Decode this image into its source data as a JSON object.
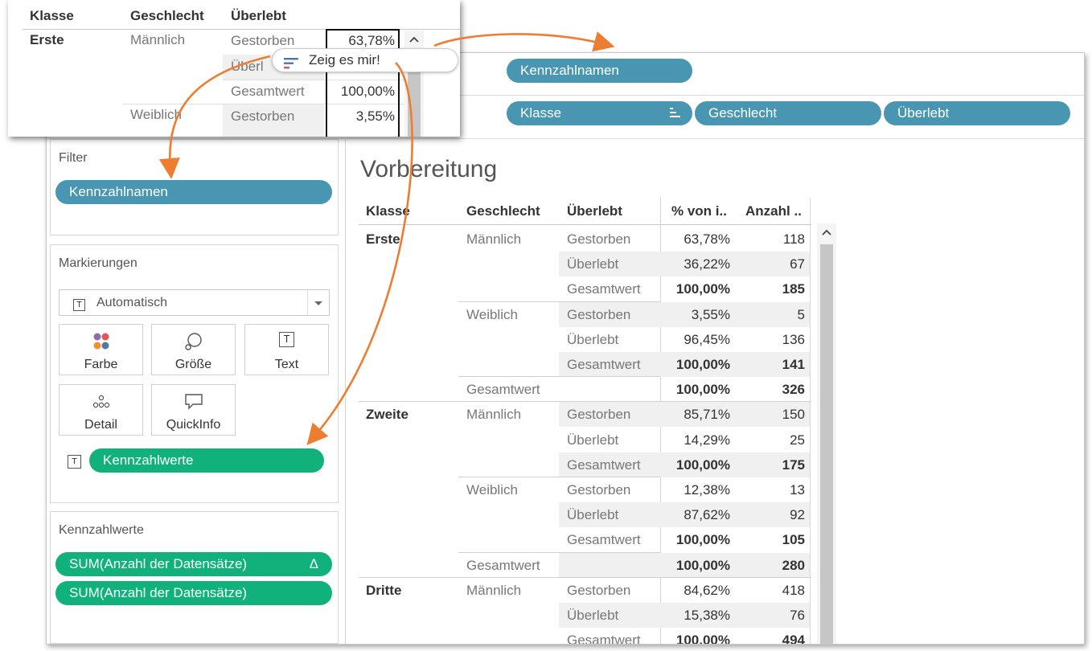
{
  "columns_shelf": {
    "pill": "Kennzahlnamen"
  },
  "rows_shelf": {
    "pills": [
      "Klasse",
      "Geschlecht",
      "Überlebt"
    ]
  },
  "filter": {
    "title": "Filter",
    "pill": "Kennzahlnamen"
  },
  "marks": {
    "title": "Markierungen",
    "type_value": "Automatisch",
    "buttons": [
      "Farbe",
      "Größe",
      "Text",
      "Detail",
      "QuickInfo"
    ],
    "text_pill": "Kennzahlwerte"
  },
  "measure_values": {
    "title": "Kennzahlwerte",
    "pills": [
      "SUM(Anzahl der Datensätze)",
      "SUM(Anzahl der Datensätze)"
    ],
    "delta": "Δ"
  },
  "sheet": {
    "title": "Vorbereitung"
  },
  "table": {
    "headers": [
      "Klasse",
      "Geschlecht",
      "Überlebt",
      "% von i..",
      "Anzahl .."
    ],
    "rows": [
      {
        "klasse": "Erste",
        "geschlecht": "Männlich",
        "ueberlebt": "Gestorben",
        "pct": "63,78%",
        "cnt": "118"
      },
      {
        "klasse": "",
        "geschlecht": "",
        "ueberlebt": "Überlebt",
        "pct": "36,22%",
        "cnt": "67"
      },
      {
        "klasse": "",
        "geschlecht": "",
        "ueberlebt": "Gesamtwert",
        "pct": "100,00%",
        "cnt": "185"
      },
      {
        "klasse": "",
        "geschlecht": "Weiblich",
        "ueberlebt": "Gestorben",
        "pct": "3,55%",
        "cnt": "5"
      },
      {
        "klasse": "",
        "geschlecht": "",
        "ueberlebt": "Überlebt",
        "pct": "96,45%",
        "cnt": "136"
      },
      {
        "klasse": "",
        "geschlecht": "",
        "ueberlebt": "Gesamtwert",
        "pct": "100,00%",
        "cnt": "141"
      },
      {
        "klasse": "",
        "geschlecht": "Gesamtwert",
        "ueberlebt": "",
        "pct": "100,00%",
        "cnt": "326"
      },
      {
        "klasse": "Zweite",
        "geschlecht": "Männlich",
        "ueberlebt": "Gestorben",
        "pct": "85,71%",
        "cnt": "150"
      },
      {
        "klasse": "",
        "geschlecht": "",
        "ueberlebt": "Überlebt",
        "pct": "14,29%",
        "cnt": "25"
      },
      {
        "klasse": "",
        "geschlecht": "",
        "ueberlebt": "Gesamtwert",
        "pct": "100,00%",
        "cnt": "175"
      },
      {
        "klasse": "",
        "geschlecht": "Weiblich",
        "ueberlebt": "Gestorben",
        "pct": "12,38%",
        "cnt": "13"
      },
      {
        "klasse": "",
        "geschlecht": "",
        "ueberlebt": "Überlebt",
        "pct": "87,62%",
        "cnt": "92"
      },
      {
        "klasse": "",
        "geschlecht": "",
        "ueberlebt": "Gesamtwert",
        "pct": "100,00%",
        "cnt": "105"
      },
      {
        "klasse": "",
        "geschlecht": "Gesamtwert",
        "ueberlebt": "",
        "pct": "100,00%",
        "cnt": "280"
      },
      {
        "klasse": "Dritte",
        "geschlecht": "Männlich",
        "ueberlebt": "Gestorben",
        "pct": "84,62%",
        "cnt": "418"
      },
      {
        "klasse": "",
        "geschlecht": "",
        "ueberlebt": "Überlebt",
        "pct": "15,38%",
        "cnt": "76"
      },
      {
        "klasse": "",
        "geschlecht": "",
        "ueberlebt": "Gesamtwert",
        "pct": "100,00%",
        "cnt": "494"
      }
    ]
  },
  "popup": {
    "headers": [
      "Klasse",
      "Geschlecht",
      "Überlebt"
    ],
    "rows": [
      {
        "klasse": "Erste",
        "geschlecht": "Männlich",
        "ueberlebt": "Gestorben",
        "pct": "63,78%"
      },
      {
        "klasse": "",
        "geschlecht": "",
        "ueberlebt": "Überl",
        "pct": ""
      },
      {
        "klasse": "",
        "geschlecht": "",
        "ueberlebt": "Gesamtwert",
        "pct": "100,00%"
      },
      {
        "klasse": "",
        "geschlecht": "Weiblich",
        "ueberlebt": "Gestorben",
        "pct": "3,55%"
      }
    ],
    "tooltip": "Zeig es mir!"
  },
  "colors": {
    "blue_pill": "#4996b2",
    "green_pill": "#10b17b",
    "arrow": "#ed7d31",
    "row_shade": "#f0f0f0"
  }
}
